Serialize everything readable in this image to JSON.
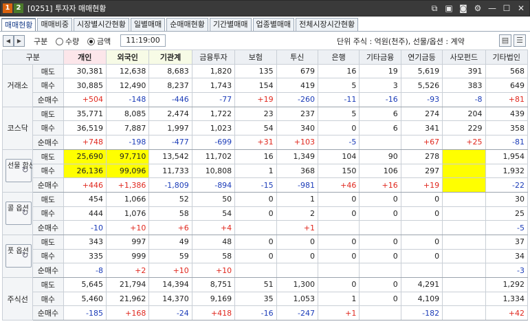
{
  "window": {
    "badges": [
      "1",
      "2"
    ],
    "title": "[0251] 투자자 매매현황"
  },
  "tabs": [
    "매매현황",
    "매매비중",
    "시장별시간현황",
    "일별매매",
    "순매매현황",
    "기간별매매",
    "업종별매매",
    "전체시장시간현황"
  ],
  "toolbar": {
    "group_label": "구분",
    "radio_qty": "수량",
    "radio_amt": "금액",
    "selected": "금액",
    "time": "11:19:00",
    "unit_text": "단위 주식 : 억원(천주), 선물/옵션 : 계약"
  },
  "columns": [
    "구분",
    "개인",
    "외국인",
    "기관계",
    "금융투자",
    "보험",
    "투신",
    "은행",
    "기타금융",
    "연기금등",
    "사모펀드",
    "기타법인"
  ],
  "groups": [
    {
      "name": "거래소",
      "rows": [
        {
          "label": "매도",
          "values": [
            "30,381",
            "12,638",
            "8,683",
            "1,820",
            "135",
            "679",
            "16",
            "19",
            "5,619",
            "391",
            "568"
          ]
        },
        {
          "label": "매수",
          "values": [
            "30,885",
            "12,490",
            "8,237",
            "1,743",
            "154",
            "419",
            "5",
            "3",
            "5,526",
            "383",
            "649"
          ]
        },
        {
          "label": "순매수",
          "values": [
            "+504",
            "-148",
            "-446",
            "-77",
            "+19",
            "-260",
            "-11",
            "-16",
            "-93",
            "-8",
            "+81"
          ]
        }
      ]
    },
    {
      "name": "코스닥",
      "rows": [
        {
          "label": "매도",
          "values": [
            "35,771",
            "8,085",
            "2,474",
            "1,722",
            "23",
            "237",
            "5",
            "6",
            "274",
            "204",
            "439"
          ]
        },
        {
          "label": "매수",
          "values": [
            "36,519",
            "7,887",
            "1,997",
            "1,023",
            "54",
            "340",
            "0",
            "6",
            "341",
            "229",
            "358"
          ]
        },
        {
          "label": "순매수",
          "values": [
            "+748",
            "-198",
            "-477",
            "-699",
            "+31",
            "+103",
            "-5",
            "",
            "+67",
            "+25",
            "-81"
          ]
        }
      ]
    },
    {
      "name": "선물 합산",
      "button": true,
      "rows": [
        {
          "label": "매도",
          "values": [
            "25,690",
            "97,710",
            "13,542",
            "11,702",
            "16",
            "1,349",
            "104",
            "90",
            "278",
            "",
            "1,954"
          ]
        },
        {
          "label": "매수",
          "values": [
            "26,136",
            "99,096",
            "11,733",
            "10,808",
            "1",
            "368",
            "150",
            "106",
            "297",
            "",
            "1,932"
          ]
        },
        {
          "label": "순매수",
          "values": [
            "+446",
            "+1,386",
            "-1,809",
            "-894",
            "-15",
            "-981",
            "+46",
            "+16",
            "+19",
            "",
            "-22"
          ]
        }
      ]
    },
    {
      "name": "콜 옵션",
      "button": true,
      "rows": [
        {
          "label": "매도",
          "values": [
            "454",
            "1,066",
            "52",
            "50",
            "0",
            "1",
            "0",
            "0",
            "0",
            "",
            "30"
          ]
        },
        {
          "label": "매수",
          "values": [
            "444",
            "1,076",
            "58",
            "54",
            "0",
            "2",
            "0",
            "0",
            "0",
            "",
            "25"
          ]
        },
        {
          "label": "순매수",
          "values": [
            "-10",
            "+10",
            "+6",
            "+4",
            "",
            "+1",
            "",
            "",
            "",
            "",
            "-5"
          ]
        }
      ]
    },
    {
      "name": "풋 옵션",
      "button": true,
      "rows": [
        {
          "label": "매도",
          "values": [
            "343",
            "997",
            "49",
            "48",
            "0",
            "0",
            "0",
            "0",
            "0",
            "",
            "37"
          ]
        },
        {
          "label": "매수",
          "values": [
            "335",
            "999",
            "59",
            "58",
            "0",
            "0",
            "0",
            "0",
            "0",
            "",
            "34"
          ]
        },
        {
          "label": "순매수",
          "values": [
            "-8",
            "+2",
            "+10",
            "+10",
            "",
            "",
            "",
            "",
            "",
            "",
            "-3"
          ]
        }
      ]
    },
    {
      "name": "주식선",
      "rows": [
        {
          "label": "매도",
          "values": [
            "5,645",
            "21,794",
            "14,394",
            "8,751",
            "51",
            "1,300",
            "0",
            "0",
            "4,291",
            "",
            "1,292"
          ]
        },
        {
          "label": "매수",
          "values": [
            "5,460",
            "21,962",
            "14,370",
            "9,169",
            "35",
            "1,053",
            "1",
            "0",
            "4,109",
            "",
            "1,334"
          ]
        },
        {
          "label": "순매수",
          "values": [
            "-185",
            "+168",
            "-24",
            "+418",
            "-16",
            "-247",
            "+1",
            "",
            "-182",
            "",
            "+42"
          ]
        }
      ]
    }
  ],
  "highlight_color": "#ffff00",
  "positive_color": "#e0271d",
  "negative_color": "#1a3bb8"
}
